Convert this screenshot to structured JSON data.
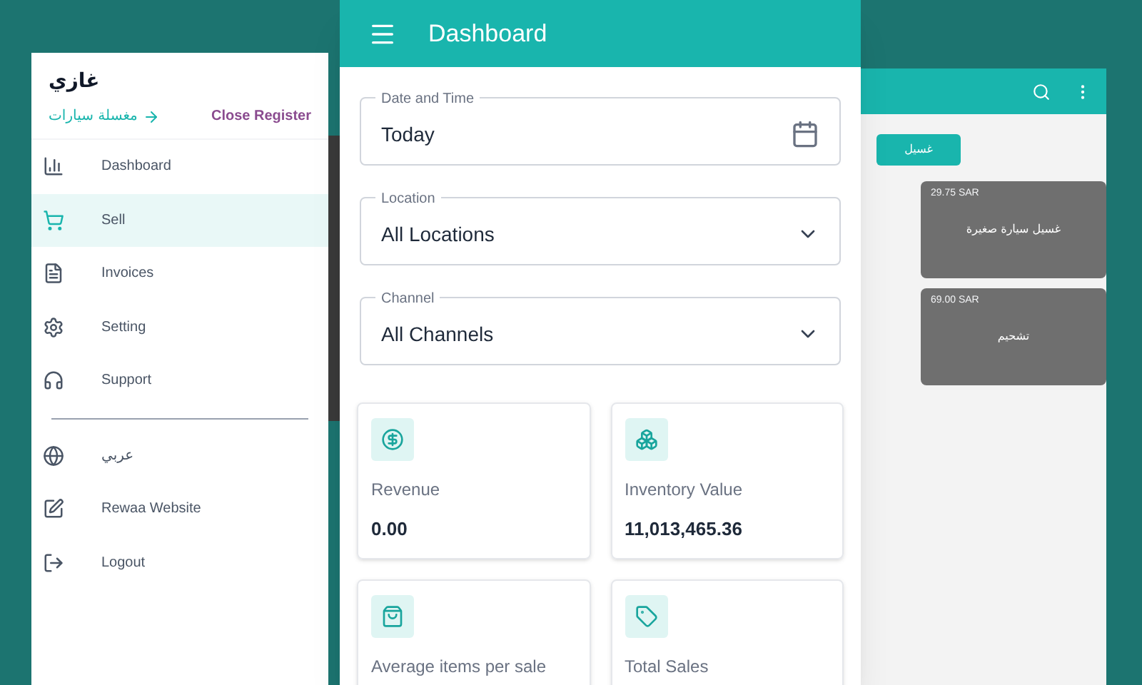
{
  "drawer": {
    "user_name": "غازي",
    "store_name": "مغسلة سيارات",
    "close_register": "Close Register",
    "items": [
      {
        "label": "Dashboard",
        "selected": false
      },
      {
        "label": "Sell",
        "selected": true
      },
      {
        "label": "Invoices",
        "selected": false
      },
      {
        "label": "Setting",
        "selected": false
      },
      {
        "label": "Support",
        "selected": false
      }
    ],
    "secondary_items": [
      {
        "label": "عربي",
        "kind": "arabic"
      },
      {
        "label": "Rewaa Website",
        "kind": "latin"
      },
      {
        "label": "Logout",
        "kind": "latin"
      }
    ]
  },
  "dashboard": {
    "title": "Dashboard",
    "filters": [
      {
        "label": "Date and Time",
        "value": "Today",
        "kind": "date"
      },
      {
        "label": "Location",
        "value": "All Locations",
        "kind": "select"
      },
      {
        "label": "Channel",
        "value": "All Channels",
        "kind": "select"
      }
    ],
    "stats": [
      {
        "label": "Revenue",
        "value": "0.00"
      },
      {
        "label": "Inventory Value",
        "value": "11,013,465.36"
      },
      {
        "label": "Average items per sale"
      },
      {
        "label": "Total Sales"
      }
    ]
  },
  "sell": {
    "action_button": "غسيل",
    "products": [
      {
        "price": "29.75 SAR",
        "name": "غسيل سيارة صغيرة"
      },
      {
        "price": "69.00 SAR",
        "name": "تشحيم"
      }
    ]
  }
}
